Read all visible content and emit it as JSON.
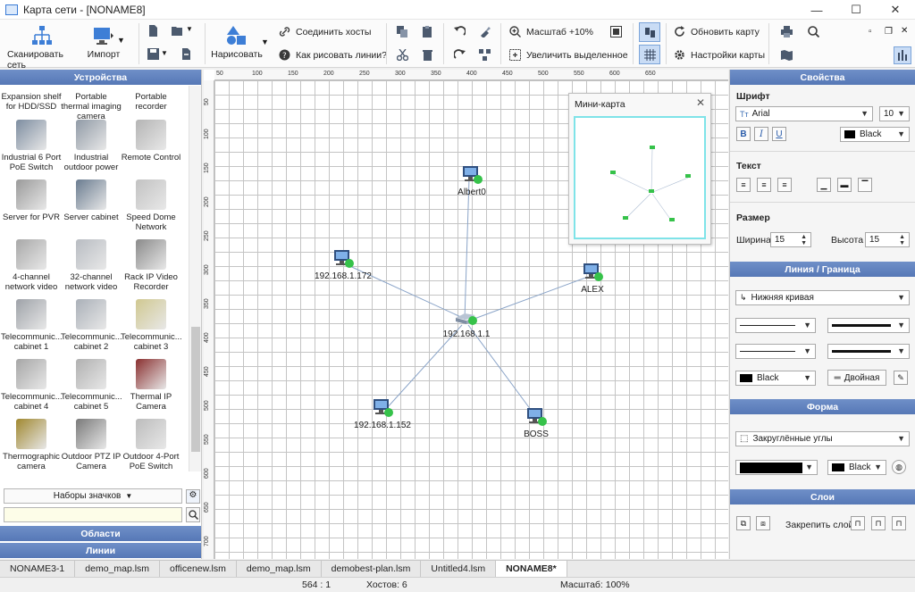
{
  "window": {
    "title": "Карта сети - [NONAME8]",
    "min": "—",
    "max": "☐",
    "close": "✕"
  },
  "ribbon": {
    "scan": "Сканировать сеть",
    "import": "Импорт",
    "draw": "Нарисовать",
    "connect": "Соединить хосты",
    "how_lines": "Как рисовать линии?",
    "zoom": "Масштаб +10%",
    "zoom_sel": "Увеличить выделенное",
    "refresh": "Обновить карту",
    "map_settings": "Настройки карты"
  },
  "left_panel": {
    "title": "Устройства",
    "devices": [
      "Expansion shelf for HDD/SSD",
      "Portable thermal imaging camera",
      "Portable recorder",
      "Industrial 6 Port PoE Switch",
      "Industrial outdoor power",
      "Remote Control",
      "Server for PVR",
      "Server cabinet",
      "Speed Dome Network",
      "4-channel network video",
      "32-channel network video",
      "Rack IP Video Recorder",
      "Telecommunic... cabinet 1",
      "Telecommunic... cabinet 2",
      "Telecommunic... cabinet 3",
      "Telecommunic... cabinet 4",
      "Telecommunic... cabinet 5",
      "Thermal IP Camera",
      "Thermographic camera",
      "Outdoor PTZ IP Camera",
      "Outdoor 4-Port PoE Switch"
    ],
    "icon_sets": "Наборы значков",
    "search_value": "",
    "areas": "Области",
    "lines": "Линии"
  },
  "ruler": {
    "top": [
      "50",
      "100",
      "150",
      "200",
      "250",
      "300",
      "350",
      "400",
      "450",
      "500",
      "550",
      "600",
      "650"
    ],
    "left": [
      "50",
      "100",
      "150",
      "200",
      "250",
      "300",
      "350",
      "400",
      "450",
      "500",
      "550",
      "600",
      "650",
      "700"
    ]
  },
  "nodes": {
    "albert": "Albert0",
    "n172": "192.168.1.172",
    "alex": "ALEX",
    "hub": "192.168.1.1",
    "n152": "192.168.1.152",
    "boss": "BOSS"
  },
  "minimap": {
    "title": "Мини-карта"
  },
  "right_panel": {
    "title": "Свойства",
    "font_section": "Шрифт",
    "font_name": "Arial",
    "font_size": "10",
    "font_color": "Black",
    "text_section": "Текст",
    "size_section": "Размер",
    "width_label": "Ширина",
    "width_value": "15",
    "height_label": "Высота",
    "height_value": "15",
    "line_title": "Линия / Граница",
    "line_type": "Нижняя кривая",
    "line_color": "Black",
    "double_btn": "Двойная",
    "shape_title": "Форма",
    "shape_type": "Закруглённые углы",
    "shape_color": "Black",
    "layers_title": "Слои",
    "pin_layer": "Закрепить слой:"
  },
  "tabs": [
    "NONAME3-1",
    "demo_map.lsm",
    "officenew.lsm",
    "demo_map.lsm",
    "demobest-plan.lsm",
    "Untitled4.lsm",
    "NONAME8*"
  ],
  "status": {
    "coords": "564 : 1",
    "hosts": "Хостов: 6",
    "zoom": "Масштаб: 100%"
  },
  "colors": {
    "panel_header": "#5f80bd",
    "link_line": "#8aa4c8",
    "minimap_border": "#7fe3e8"
  }
}
